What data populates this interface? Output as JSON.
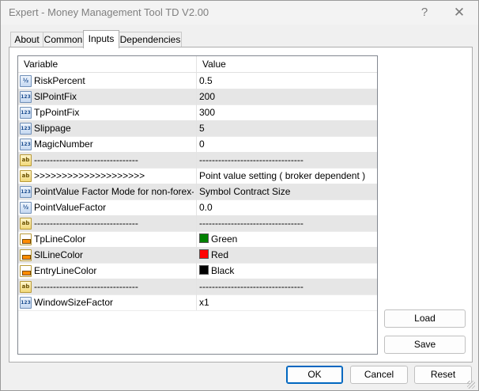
{
  "window": {
    "title": "Expert - Money Management Tool TD V2.00",
    "help_glyph": "?",
    "close_glyph": "✕"
  },
  "tabs": [
    {
      "label": "About",
      "active": false
    },
    {
      "label": "Common",
      "active": false
    },
    {
      "label": "Inputs",
      "active": true
    },
    {
      "label": "Dependencies",
      "active": false
    }
  ],
  "grid": {
    "headers": {
      "variable": "Variable",
      "value": "Value"
    },
    "rows": [
      {
        "icon": "double-type-icon",
        "icon_text": "½",
        "name": "RiskPercent",
        "value": "0.5"
      },
      {
        "icon": "integer-type-icon",
        "icon_text": "123",
        "name": "SlPointFix",
        "value": "200"
      },
      {
        "icon": "integer-type-icon",
        "icon_text": "123",
        "name": "TpPointFix",
        "value": "300"
      },
      {
        "icon": "integer-type-icon",
        "icon_text": "123",
        "name": "Slippage",
        "value": "5"
      },
      {
        "icon": "integer-type-icon",
        "icon_text": "123",
        "name": "MagicNumber",
        "value": "0"
      },
      {
        "icon": "string-type-icon",
        "icon_text": "ab",
        "name": "---------------------------------",
        "value": "---------------------------------"
      },
      {
        "icon": "string-type-icon",
        "icon_text": "ab",
        "name": ">>>>>>>>>>>>>>>>>>>>",
        "value": "Point value setting ( broker dependent )"
      },
      {
        "icon": "integer-type-icon",
        "icon_text": "123",
        "name": "PointValue Factor Mode for non-forex-sy...",
        "value": "Symbol Contract Size"
      },
      {
        "icon": "double-type-icon",
        "icon_text": "½",
        "name": "PointValueFactor",
        "value": "0.0"
      },
      {
        "icon": "string-type-icon",
        "icon_text": "ab",
        "name": "---------------------------------",
        "value": "---------------------------------"
      },
      {
        "icon": "color-type-icon",
        "icon_text": "",
        "name": "TpLineColor",
        "value": "Green",
        "swatch": "#008000"
      },
      {
        "icon": "color-type-icon",
        "icon_text": "",
        "name": "SlLineColor",
        "value": "Red",
        "swatch": "#ff0000"
      },
      {
        "icon": "color-type-icon",
        "icon_text": "",
        "name": "EntryLineColor",
        "value": "Black",
        "swatch": "#000000"
      },
      {
        "icon": "string-type-icon",
        "icon_text": "ab",
        "name": "---------------------------------",
        "value": "---------------------------------"
      },
      {
        "icon": "integer-type-icon",
        "icon_text": "123",
        "name": "WindowSizeFactor",
        "value": "x1"
      }
    ]
  },
  "side_buttons": {
    "load": "Load",
    "save": "Save"
  },
  "footer": {
    "ok": "OK",
    "cancel": "Cancel",
    "reset": "Reset"
  }
}
